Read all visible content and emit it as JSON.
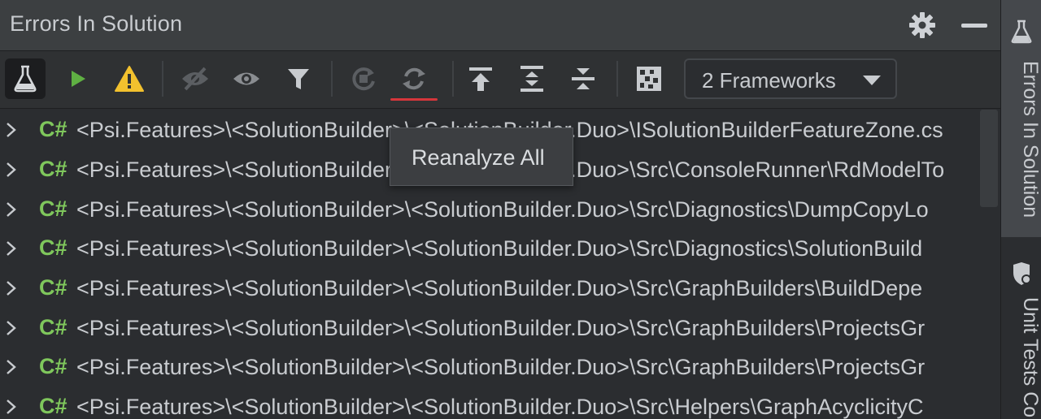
{
  "window": {
    "title": "Errors In Solution"
  },
  "toolbar": {
    "buttons": [
      {
        "name": "unit-test-session-button",
        "tooltip": ""
      },
      {
        "name": "run-button",
        "tooltip": ""
      },
      {
        "name": "warnings-button",
        "tooltip": ""
      },
      {
        "name": "hide-button",
        "tooltip": ""
      },
      {
        "name": "show-button",
        "tooltip": ""
      },
      {
        "name": "filter-button",
        "tooltip": ""
      },
      {
        "name": "stop-analysis-button",
        "tooltip": ""
      },
      {
        "name": "reanalyze-all-button",
        "tooltip": "Reanalyze All"
      },
      {
        "name": "scroll-to-top-button",
        "tooltip": ""
      },
      {
        "name": "expand-all-button",
        "tooltip": ""
      },
      {
        "name": "collapse-all-button",
        "tooltip": ""
      },
      {
        "name": "analysis-icon-button",
        "tooltip": ""
      }
    ],
    "frameworks_label": "2 Frameworks"
  },
  "tooltip": {
    "text": "Reanalyze All"
  },
  "tree": {
    "rows": [
      {
        "lang": "C#",
        "path": "<Psi.Features>\\<SolutionBuilder>\\<SolutionBuilder.Duo>\\ISolutionBuilderFeatureZone.cs"
      },
      {
        "lang": "C#",
        "path": "<Psi.Features>\\<SolutionBuilder>\\<SolutionBuilder.Duo>\\Src\\ConsoleRunner\\RdModelTo"
      },
      {
        "lang": "C#",
        "path": "<Psi.Features>\\<SolutionBuilder>\\<SolutionBuilder.Duo>\\Src\\Diagnostics\\DumpCopyLo"
      },
      {
        "lang": "C#",
        "path": "<Psi.Features>\\<SolutionBuilder>\\<SolutionBuilder.Duo>\\Src\\Diagnostics\\SolutionBuild"
      },
      {
        "lang": "C#",
        "path": "<Psi.Features>\\<SolutionBuilder>\\<SolutionBuilder.Duo>\\Src\\GraphBuilders\\BuildDepe"
      },
      {
        "lang": "C#",
        "path": "<Psi.Features>\\<SolutionBuilder>\\<SolutionBuilder.Duo>\\Src\\GraphBuilders\\ProjectsGr"
      },
      {
        "lang": "C#",
        "path": "<Psi.Features>\\<SolutionBuilder>\\<SolutionBuilder.Duo>\\Src\\GraphBuilders\\ProjectsGr"
      },
      {
        "lang": "C#",
        "path": "<Psi.Features>\\<SolutionBuilder>\\<SolutionBuilder.Duo>\\Src\\Helpers\\GraphAcyclicityC"
      }
    ]
  },
  "stripe": {
    "tab1_label": "Errors In Solution",
    "tab2_label": "Unit Tests Co"
  },
  "colors": {
    "accent_green": "#7fc75c",
    "warning_yellow": "#f2c12e",
    "active_underline": "#d6363b",
    "background": "#2b2d30"
  }
}
